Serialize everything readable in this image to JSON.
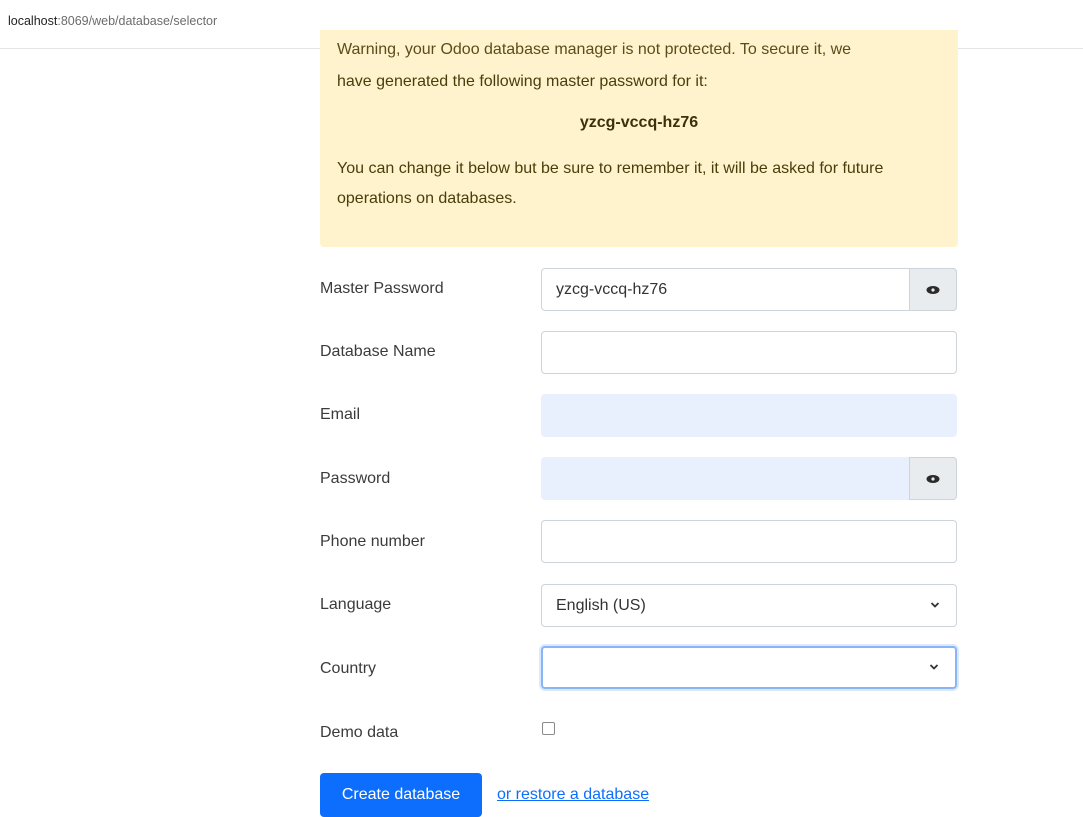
{
  "browser": {
    "url_host": "localhost",
    "url_rest": ":8069/web/database/selector"
  },
  "alert": {
    "cut_line": "Warning, your Odoo database manager is not protected. To secure it, we",
    "line1": "have generated the following master password for it:",
    "generated_password": "yzcg-vccq-hz76",
    "note": "You can change it below but be sure to remember it, it will be asked for future operations on databases."
  },
  "form": {
    "master_password": {
      "label": "Master Password",
      "value": "yzcg-vccq-hz76"
    },
    "database_name": {
      "label": "Database Name",
      "value": ""
    },
    "email": {
      "label": "Email",
      "value": ""
    },
    "password": {
      "label": "Password",
      "value": ""
    },
    "phone": {
      "label": "Phone number",
      "value": ""
    },
    "language": {
      "label": "Language",
      "value": "English (US)"
    },
    "country": {
      "label": "Country",
      "value": ""
    },
    "demo_data": {
      "label": "Demo data",
      "checked": false
    }
  },
  "actions": {
    "create_label": "Create database",
    "restore_label": "or restore a database"
  },
  "icons": {
    "reveal": "eye-icon",
    "dropdown": "chevron-down-icon"
  },
  "colors": {
    "primary": "#0d6efd",
    "alert_bg": "#fff3cd",
    "autofill_bg": "#e8f0fe"
  }
}
